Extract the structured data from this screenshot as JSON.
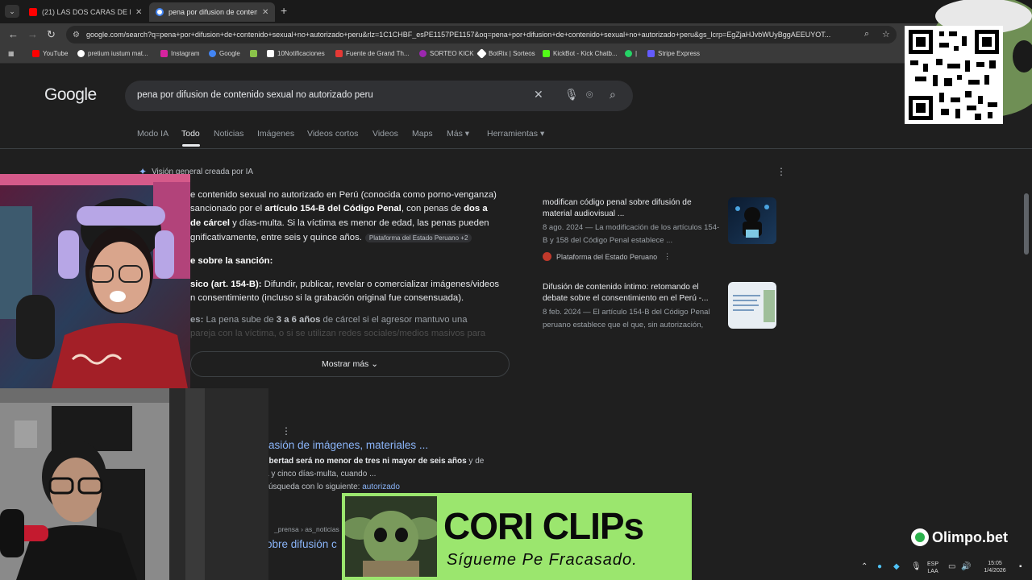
{
  "browser": {
    "tabs": [
      {
        "title": "(21) LAS DOS CARAS DE LA MO",
        "active": false,
        "favicon_color": "#ff0000"
      },
      {
        "title": "pena por difusion de contenido",
        "active": true,
        "favicon_color": "#4285f4"
      }
    ],
    "new_tab_label": "+",
    "url": "google.com/search?q=pena+por+difusion+de+contenido+sexual+no+autorizado+peru&rlz=1C1CHBF_esPE1157PE1157&oq=pena+por+difusion+de+contenido+sexual+no+autorizado+peru&gs_lcrp=EgZjaHJvbWUyBggAEEUYOT...",
    "bookmarks": [
      {
        "label": "YouTube",
        "color": "#ff0000"
      },
      {
        "label": "pretium iustum mat...",
        "color": "#ffffff"
      },
      {
        "label": "Instagram",
        "color": "#d6249f"
      },
      {
        "label": "Google",
        "color": "#4285f4"
      },
      {
        "label": "",
        "color": "#8bc34a"
      },
      {
        "label": "10Notificaciones",
        "color": "#ffffff"
      },
      {
        "label": "Fuente de Grand Th...",
        "color": "#e53935"
      },
      {
        "label": "SORTEO KICK",
        "color": "#9c27b0"
      },
      {
        "label": "BotRix | Sorteos",
        "color": "#ffffff"
      },
      {
        "label": "KickBot - Kick Chatb...",
        "color": "#53fc18"
      },
      {
        "label": "|",
        "color": "#25d366"
      },
      {
        "label": "Stripe Express",
        "color": "#635bff"
      }
    ]
  },
  "google": {
    "logo": "Google",
    "query": "pena por difusion de contenido sexual no autorizado peru",
    "tabs": [
      "Modo IA",
      "Todo",
      "Noticias",
      "Imágenes",
      "Videos cortos",
      "Videos",
      "Maps",
      "Más ▾",
      "Herramientas ▾"
    ],
    "ai_overview": {
      "heading": "Visión general creada por IA",
      "line1": "e contenido sexual no autorizado en Perú (conocida como porno-venganza)",
      "line2_a": "sancionado por el ",
      "line2_b": "artículo 154-B del Código Penal",
      "line2_c": ", con penas de ",
      "line2_d": "dos a",
      "line3_a": "de cárcel",
      "line3_b": " y días-multa. Si la víctima es menor de edad, las penas pueden",
      "line4": "gnificativamente, entre seis y quince años.",
      "source_chip": "Plataforma del Estado Peruano +2",
      "subheading": "e sobre la sanción:",
      "line5_a": "sico (art. 154-B):",
      "line5_b": " Difundir, publicar, revelar o comercializar imágenes/videos",
      "line6": "n consentimiento (incluso si la grabación original fue consensuada).",
      "line7_a": "es:",
      "line7_b": " La pena sube de ",
      "line7_c": "3 a 6 años",
      "line7_d": " de cárcel si el agresor mantuvo una",
      "line8": "pareja con la víctima, o si se utilizan redes sociales/medios masivos para",
      "show_more": "Mostrar más"
    },
    "cards": [
      {
        "title": "modifican código penal sobre difusión de material audiovisual ...",
        "snippet": "8 ago. 2024 — La modificación de los artículos 154-B y 158 del Código Penal establece ...",
        "source": "Plataforma del Estado Peruano"
      },
      {
        "title": "Difusión de contenido íntimo: retomando el debate sobre el consentimiento en el Perú -...",
        "snippet": "8 feb. 2024 — El artículo 154-B del Código Penal peruano establece que el que, sin autorización,"
      }
    ],
    "results": [
      {
        "title": "asión de imágenes, materiales ...",
        "snip1_b": "libertad será no menor de tres ni mayor de seis años",
        "snip1_c": " y de",
        "snip2": "a y cinco días-multa, cuando ...",
        "snip3_a": "úsqueda con lo siguiente: ",
        "snip3_b": "autorizado"
      },
      {
        "crumb": "_prensa › as_noticias",
        "title": "obre difusión c"
      }
    ]
  },
  "overlay": {
    "banner_title": "CORI CLIPs",
    "banner_subtitle": "Sígueme Pe Fracasado.",
    "sponsor": "Olimpo.bet",
    "tray_lang_1": "ESP",
    "tray_lang_2": "LAA",
    "clock_time": "15:05",
    "clock_date": "1/4/2026"
  },
  "colors": {
    "accent_link": "#8ab4f8",
    "banner_green": "#9be66e",
    "page_bg": "#1f1f1f"
  }
}
